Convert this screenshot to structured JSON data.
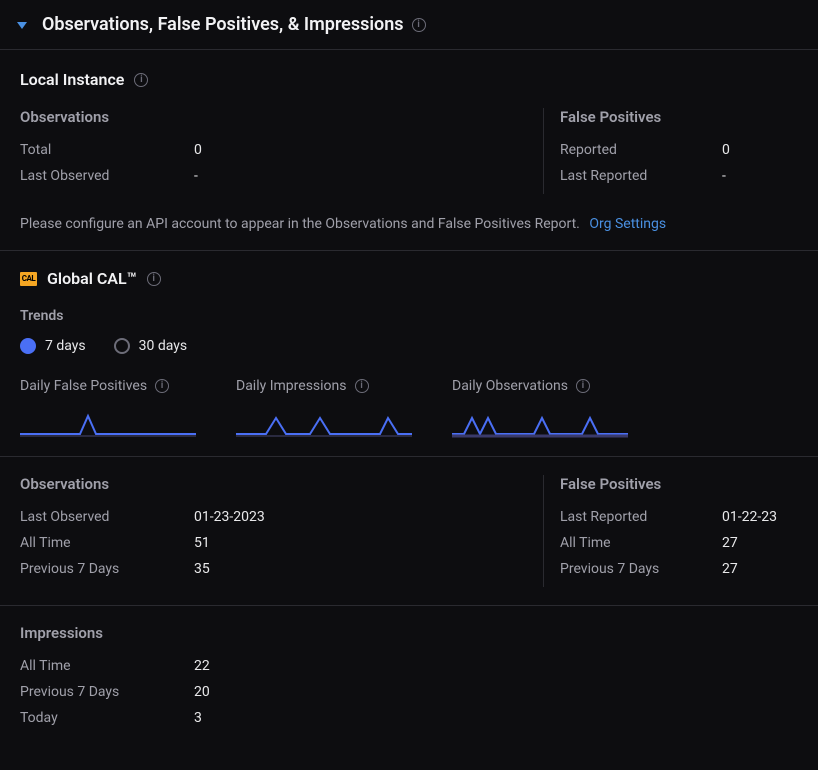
{
  "panel": {
    "title": "Observations, False Positives, & Impressions"
  },
  "local": {
    "title": "Local Instance",
    "obs_heading": "Observations",
    "obs_total_label": "Total",
    "obs_total_val": "0",
    "obs_last_label": "Last Observed",
    "obs_last_val": "-",
    "fp_heading": "False Positives",
    "fp_reported_label": "Reported",
    "fp_reported_val": "0",
    "fp_last_label": "Last Reported",
    "fp_last_val": "-",
    "hint_text": "Please configure an API account to appear in the Observations and False Positives Report.",
    "hint_link": "Org Settings"
  },
  "global": {
    "badge": "CAL",
    "title": "Global CAL™",
    "trends_label": "Trends",
    "radio_7": "7 days",
    "radio_30": "30 days",
    "chart_fp_title": "Daily False Positives",
    "chart_imp_title": "Daily Impressions",
    "chart_obs_title": "Daily Observations"
  },
  "stats": {
    "obs_heading": "Observations",
    "obs_last_label": "Last Observed",
    "obs_last_val": "01-23-2023",
    "obs_all_label": "All Time",
    "obs_all_val": "51",
    "obs_prev_label": "Previous 7 Days",
    "obs_prev_val": "35",
    "fp_heading": "False Positives",
    "fp_last_label": "Last Reported",
    "fp_last_val": "01-22-23",
    "fp_all_label": "All Time",
    "fp_all_val": "27",
    "fp_prev_label": "Previous 7 Days",
    "fp_prev_val": "27"
  },
  "impressions": {
    "heading": "Impressions",
    "all_label": "All Time",
    "all_val": "22",
    "prev_label": "Previous 7 Days",
    "prev_val": "20",
    "today_label": "Today",
    "today_val": "3"
  },
  "chart_data": [
    {
      "type": "line",
      "title": "Daily False Positives",
      "x": [
        1,
        2,
        3,
        4,
        5,
        6,
        7
      ],
      "values": [
        0,
        0,
        1,
        0,
        0,
        0,
        0
      ]
    },
    {
      "type": "line",
      "title": "Daily Impressions",
      "x": [
        1,
        2,
        3,
        4,
        5,
        6,
        7
      ],
      "values": [
        0,
        1,
        0,
        1,
        0,
        0,
        1
      ]
    },
    {
      "type": "line",
      "title": "Daily Observations",
      "x": [
        1,
        2,
        3,
        4,
        5,
        6,
        7
      ],
      "values": [
        1,
        1,
        0,
        1,
        0,
        1,
        0
      ]
    }
  ]
}
